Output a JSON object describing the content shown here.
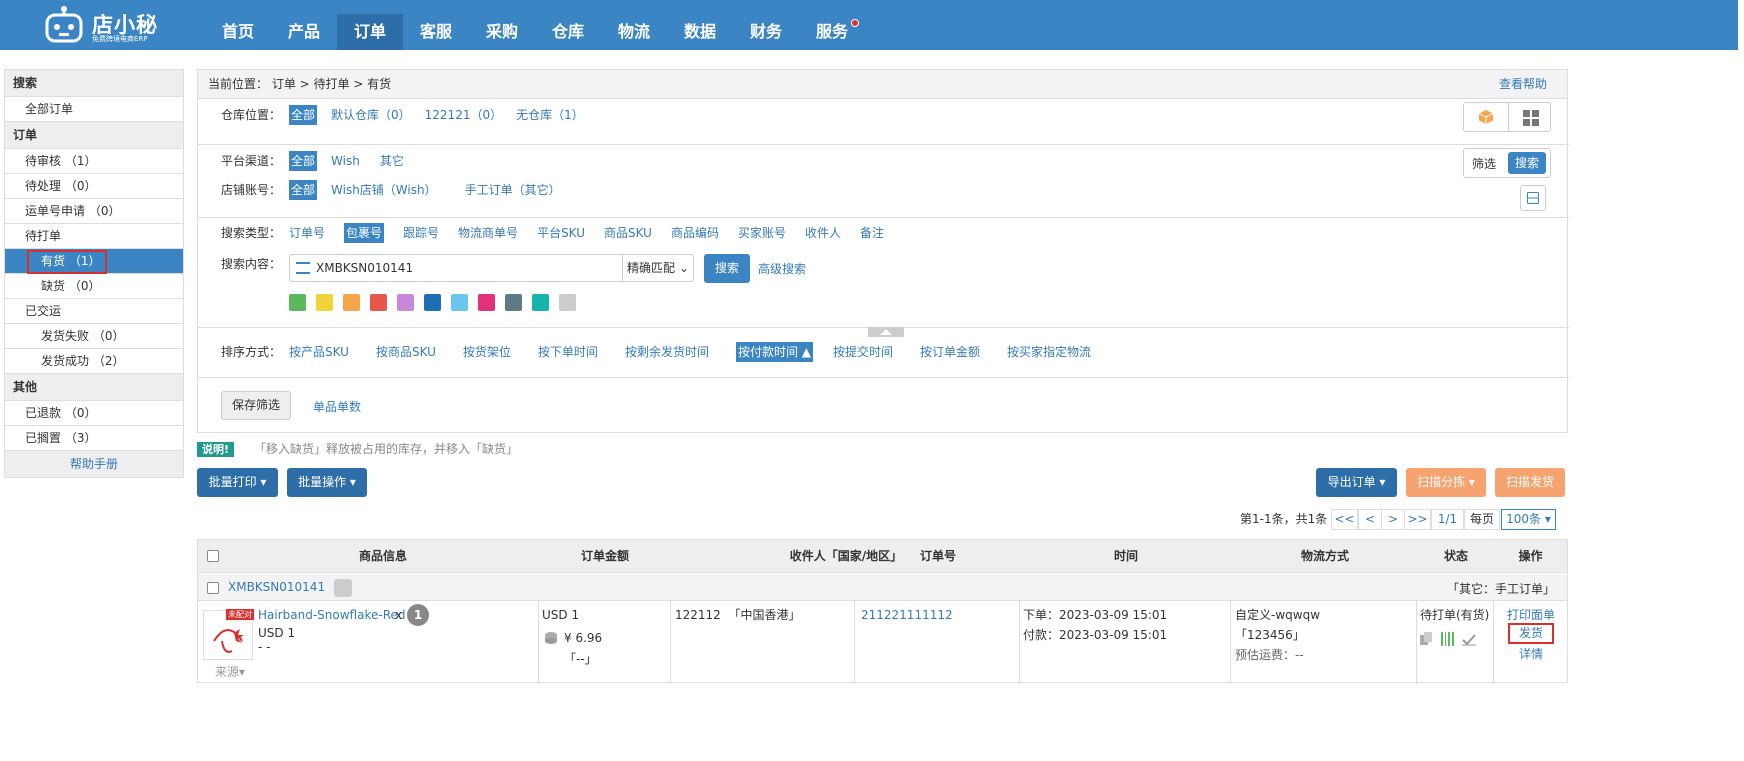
{
  "app": {
    "logo_text": "店小秘",
    "logo_sub": "免费跨境电商ERP"
  },
  "nav": [
    "首页",
    "产品",
    "订单",
    "客服",
    "采购",
    "仓库",
    "物流",
    "数据",
    "财务",
    "服务"
  ],
  "sidebar": {
    "search_head": "搜索",
    "all_orders": "全部订单",
    "orders_head": "订单",
    "pending_review": "待审核 （1）",
    "pending_process": "待处理 （0）",
    "waybill_apply": "运单号申请 （0）",
    "to_print": "待打单",
    "in_stock": "有货 （1）",
    "out_stock": "缺货 （0）",
    "shipped": "已交运",
    "ship_failed": "发货失败 （0）",
    "ship_success": "发货成功 （2）",
    "other_head": "其他",
    "refunded": "已退款 （0）",
    "shelved": "已搁置 （3）",
    "help": "帮助手册"
  },
  "crumb": {
    "text": "当前位置： 订单 > 待打单 > 有货",
    "help": "查看帮助"
  },
  "filters": {
    "warehouse_label": "仓库位置：",
    "warehouse_opts": [
      "全部",
      "默认仓库（0）",
      "122121（0）",
      "无仓库（1）"
    ],
    "channel_label": "平台渠道：",
    "channel_opts": [
      "全部",
      "Wish",
      "其它"
    ],
    "shop_label": "店铺账号：",
    "shop_opts": [
      "全部",
      "Wish店铺（Wish）",
      "手工订单（其它）"
    ],
    "filter_btn": "筛选",
    "search_btn": "搜索",
    "search_type_label": "搜索类型：",
    "search_types": [
      "订单号",
      "包裹号",
      "跟踪号",
      "物流商单号",
      "平台SKU",
      "商品SKU",
      "商品编码",
      "买家账号",
      "收件人",
      "备注"
    ],
    "search_content_label": "搜索内容：",
    "search_value": "XMBKSN010141",
    "match_mode": "精确匹配",
    "search_go": "搜索",
    "advanced": "高级搜索",
    "swatch_colors": [
      "#5cb85c",
      "#f0d43a",
      "#f7a54a",
      "#e8584a",
      "#c887d8",
      "#1f6fb5",
      "#6ac6ef",
      "#e0317a",
      "#5f7a88",
      "#16b4ab",
      "#cccccc"
    ],
    "sort_label": "排序方式：",
    "sort_opts": [
      "按产品SKU",
      "按商品SKU",
      "按货架位",
      "按下单时间",
      "按剩余发货时间",
      "按付款时间 ▲",
      "按提交时间",
      "按订单金额",
      "按买家指定物流"
    ],
    "save_filter": "保存筛选",
    "single_item": "单品单数"
  },
  "notice": {
    "badge": "说明!",
    "text": "「移入缺货」释放被占用的库存，并移入「缺货」"
  },
  "toolbar": {
    "batch_print": "批量打印 ▾",
    "batch_ops": "批量操作 ▾",
    "export": "导出订单 ▾",
    "scan_sort": "扫描分拣 ▾",
    "scan_ship": "扫描发货"
  },
  "pager": {
    "summary": "第1-1条，共1条",
    "first": "<<",
    "prev": "<",
    "next": ">",
    "last": ">>",
    "page": "1/1",
    "per_page_label": "每页",
    "per_page": "100条 ▾"
  },
  "table": {
    "headers": [
      "商品信息",
      "订单金额",
      "收件人「国家/地区」",
      "订单号",
      "时间",
      "物流方式",
      "状态",
      "操作"
    ],
    "group_id": "XMBKSN010141",
    "group_source": "「其它：手工订单」",
    "row": {
      "unmatched_tag": "未配对",
      "product_name": "Hairband-Snowflake-Red",
      "qty_x": "x",
      "qty": "1",
      "price": "USD 1",
      "dash": "- -",
      "source": "来源▾",
      "amount": "USD 1",
      "amount_cny": "¥ 6.96",
      "amount_extra": "「--」",
      "recipient": "122112  「中国香港」",
      "order_no": "211221111112",
      "order_time": "下单：2023-03-09 15:01",
      "pay_time": "付款：2023-03-09 15:01",
      "logistics": "自定义-wqwqw",
      "logistics_code": "「123456」",
      "freight": "预估运费：--",
      "status": "待打单(有货)",
      "act_print": "打印面单",
      "act_ship": "发货",
      "act_detail": "详情"
    }
  }
}
